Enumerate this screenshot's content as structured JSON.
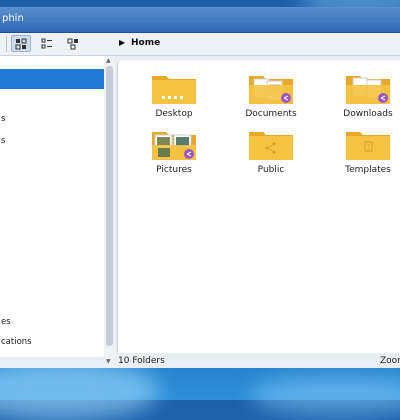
{
  "window": {
    "title": "phin"
  },
  "toolbar": {
    "breadcrumb": "Home",
    "view_icons": [
      "icons-view-icon",
      "details-view-icon",
      "split-view-icon"
    ]
  },
  "places": {
    "items": [
      {
        "label": "",
        "selected": true
      },
      {
        "label": "s"
      },
      {
        "label": "s"
      },
      {
        "label": "es"
      },
      {
        "label": "cations"
      }
    ]
  },
  "folders": [
    {
      "label": "Desktop"
    },
    {
      "label": "Documents"
    },
    {
      "label": "Downloads"
    },
    {
      "label": "Pictures"
    },
    {
      "label": "Public"
    },
    {
      "label": "Templates"
    }
  ],
  "status": {
    "count": "10 Folders",
    "zoom": "Zoom"
  },
  "colors": {
    "selection": "#1e7ad6",
    "folder": "#f5c342",
    "folder_tab": "#e8a92a",
    "badge": "#9b55c9"
  }
}
